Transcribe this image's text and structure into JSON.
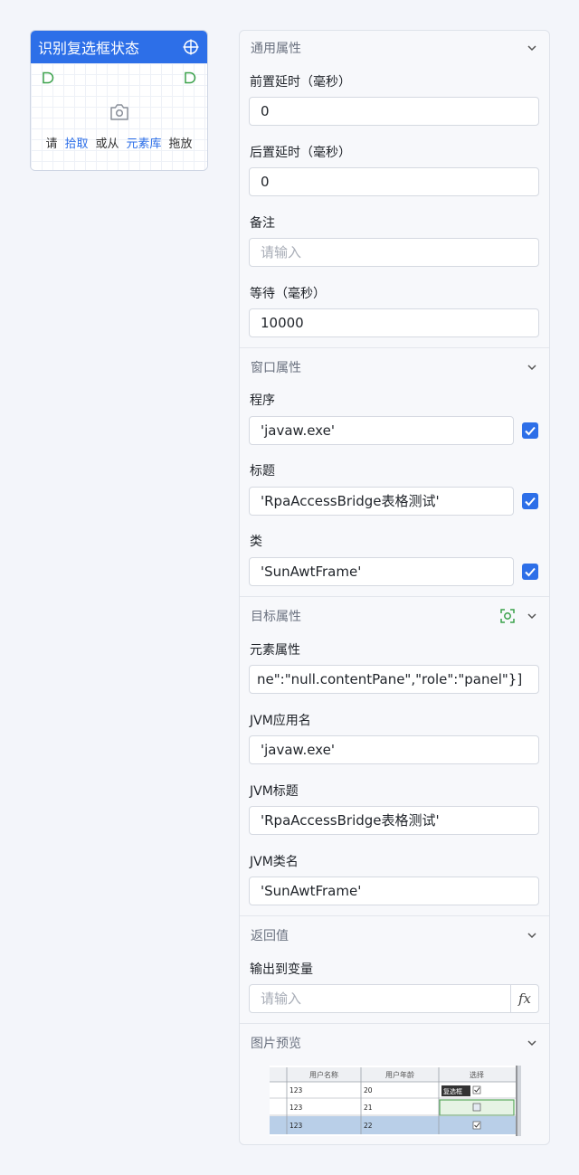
{
  "node": {
    "title": "识别复选框状态",
    "hint_please": "请",
    "hint_pick": "拾取",
    "hint_or": "或从",
    "hint_library": "元素库",
    "hint_drag": "拖放"
  },
  "general": {
    "title": "通用属性",
    "pre_delay_label": "前置延时（毫秒）",
    "pre_delay_value": "0",
    "post_delay_label": "后置延时（毫秒）",
    "post_delay_value": "0",
    "note_label": "备注",
    "note_placeholder": "请输入",
    "wait_label": "等待（毫秒）",
    "wait_value": "10000"
  },
  "window": {
    "title": "窗口属性",
    "program_label": "程序",
    "program_value": "'javaw.exe'",
    "program_checked": true,
    "caption_label": "标题",
    "caption_value": "'RpaAccessBridge表格测试'",
    "caption_checked": true,
    "class_label": "类",
    "class_value": "'SunAwtFrame'",
    "class_checked": true
  },
  "target": {
    "title": "目标属性",
    "element_label": "元素属性",
    "element_value": "ne\":\"null.contentPane\",\"role\":\"panel\"}]",
    "jvm_app_label": "JVM应用名",
    "jvm_app_value": "'javaw.exe'",
    "jvm_title_label": "JVM标题",
    "jvm_title_value": "'RpaAccessBridge表格测试'",
    "jvm_class_label": "JVM类名",
    "jvm_class_value": "'SunAwtFrame'"
  },
  "returns": {
    "title": "返回值",
    "output_label": "输出到变量",
    "output_placeholder": "请输入",
    "fx_label": "fx"
  },
  "preview": {
    "title": "图片预览",
    "headers": [
      "用户名称",
      "用户年龄",
      "选择"
    ],
    "rows": [
      {
        "name": "123",
        "age": "20",
        "tag": "复选框"
      },
      {
        "name": "123",
        "age": "21",
        "tag": ""
      },
      {
        "name": "123",
        "age": "22",
        "tag": ""
      }
    ]
  },
  "colors": {
    "accent": "#2d6fe8",
    "port_green": "#3aa14a"
  }
}
